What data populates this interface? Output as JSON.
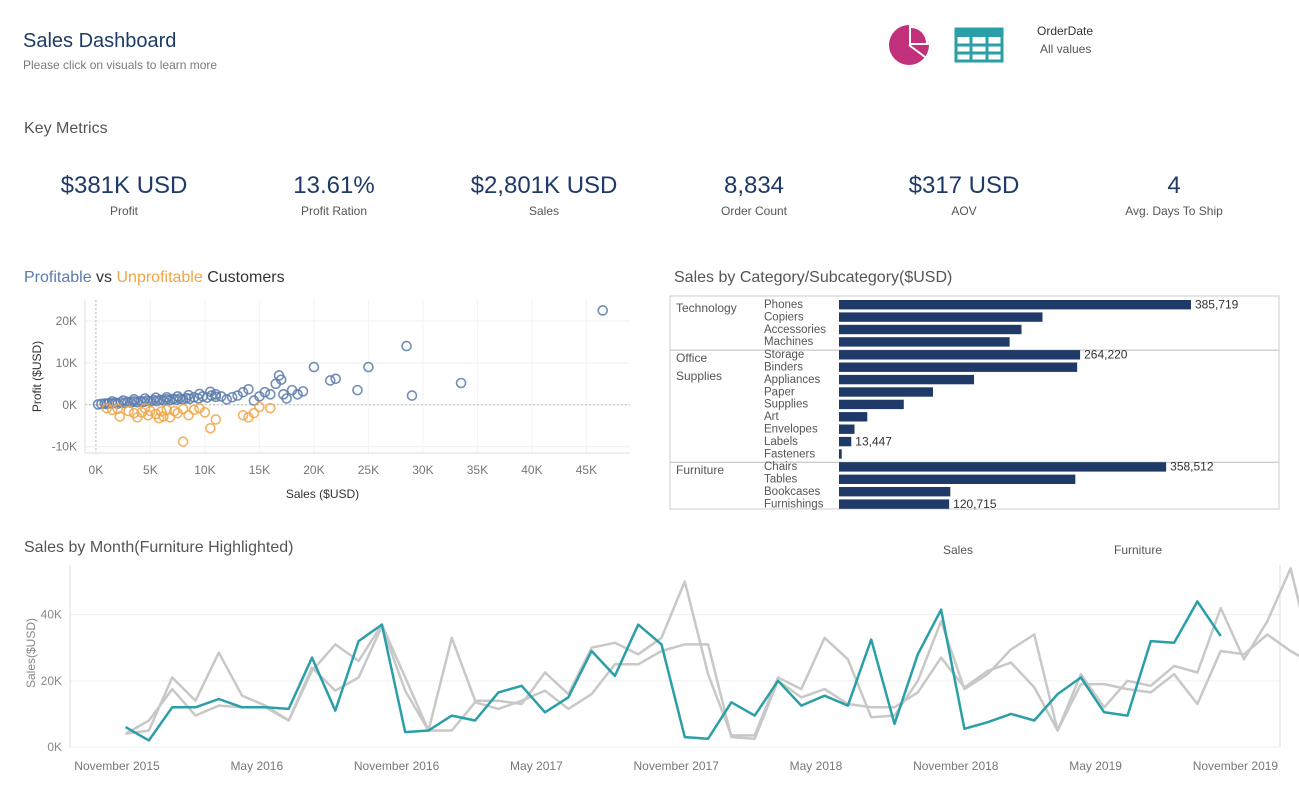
{
  "header": {
    "title": "Sales Dashboard",
    "subtitle": "Please click on visuals to learn more",
    "pie_icon": "pie-chart-icon",
    "table_icon": "table-grid-icon",
    "filter_label": "OrderDate",
    "filter_value": "All values"
  },
  "colors": {
    "navy": "#1f3a68",
    "profitable": "#5b7bab",
    "unprofitable": "#f0a646",
    "teal": "#2a9fa8",
    "gray_line": "#c8c8c8",
    "pie": "#c2307b"
  },
  "key_metrics": {
    "title": "Key Metrics",
    "items": [
      {
        "value": "$381K USD",
        "label": "Profit"
      },
      {
        "value": "13.61%",
        "label": "Profit Ration"
      },
      {
        "value": "$2,801K USD",
        "label": "Sales"
      },
      {
        "value": "8,834",
        "label": "Order Count"
      },
      {
        "value": "$317 USD",
        "label": "AOV"
      },
      {
        "value": "4",
        "label": "Avg. Days To Ship"
      }
    ]
  },
  "scatter_title": {
    "part1": "Profitable",
    "part2": " vs ",
    "part3": "Unprofitable",
    "part4": " Customers"
  },
  "bar_title": "Sales by Category/Subcategory($USD)",
  "line_title": "Sales by Month(Furniture Highlighted)",
  "chart_data": [
    {
      "type": "scatter",
      "xlabel": "Sales ($USD)",
      "ylabel": "Profit ($USD)",
      "xlim": [
        -1000,
        49000
      ],
      "ylim": [
        -11500,
        25000
      ],
      "x_ticks": [
        0,
        5000,
        10000,
        15000,
        20000,
        25000,
        30000,
        35000,
        40000,
        45000
      ],
      "x_tick_labels": [
        "0K",
        "5K",
        "10K",
        "15K",
        "20K",
        "25K",
        "30K",
        "35K",
        "40K",
        "45K"
      ],
      "y_ticks": [
        20000,
        10000,
        0,
        -10000
      ],
      "y_tick_labels": [
        "20K",
        "10K",
        "0K",
        "-10K"
      ],
      "series": [
        {
          "name": "Profitable",
          "points": [
            [
              200,
              100
            ],
            [
              500,
              200
            ],
            [
              800,
              300
            ],
            [
              1000,
              150
            ],
            [
              1200,
              400
            ],
            [
              1500,
              300
            ],
            [
              1800,
              500
            ],
            [
              2000,
              250
            ],
            [
              2300,
              600
            ],
            [
              2600,
              400
            ],
            [
              2900,
              700
            ],
            [
              3200,
              500
            ],
            [
              3500,
              800
            ],
            [
              3800,
              600
            ],
            [
              4100,
              900
            ],
            [
              4400,
              700
            ],
            [
              4700,
              1000
            ],
            [
              5000,
              800
            ],
            [
              5300,
              1100
            ],
            [
              5600,
              900
            ],
            [
              5900,
              1200
            ],
            [
              6200,
              1000
            ],
            [
              6500,
              1300
            ],
            [
              6800,
              1100
            ],
            [
              7100,
              1400
            ],
            [
              7400,
              1200
            ],
            [
              7700,
              1500
            ],
            [
              8000,
              1300
            ],
            [
              8300,
              1600
            ],
            [
              8600,
              1400
            ],
            [
              9000,
              1800
            ],
            [
              9400,
              1500
            ],
            [
              9800,
              2000
            ],
            [
              10200,
              1700
            ],
            [
              10600,
              2200
            ],
            [
              11000,
              1900
            ],
            [
              1500,
              800
            ],
            [
              2500,
              1000
            ],
            [
              3500,
              1300
            ],
            [
              4500,
              1500
            ],
            [
              5500,
              1700
            ],
            [
              6500,
              1800
            ],
            [
              7500,
              2000
            ],
            [
              8500,
              2300
            ],
            [
              9500,
              2600
            ],
            [
              10500,
              3100
            ],
            [
              11000,
              2500
            ],
            [
              11500,
              2000
            ],
            [
              12000,
              1300
            ],
            [
              12500,
              1800
            ],
            [
              13000,
              2200
            ],
            [
              13500,
              3000
            ],
            [
              14000,
              3700
            ],
            [
              14500,
              1000
            ],
            [
              15000,
              2000
            ],
            [
              15500,
              3000
            ],
            [
              16000,
              2500
            ],
            [
              16500,
              5000
            ],
            [
              16800,
              7000
            ],
            [
              17000,
              6000
            ],
            [
              17200,
              2500
            ],
            [
              17500,
              1500
            ],
            [
              18000,
              3500
            ],
            [
              18500,
              2500
            ],
            [
              19000,
              3200
            ],
            [
              20000,
              9000
            ],
            [
              21500,
              5800
            ],
            [
              22000,
              6200
            ],
            [
              24000,
              3500
            ],
            [
              25000,
              9000
            ],
            [
              28500,
              14000
            ],
            [
              29000,
              2200
            ],
            [
              33500,
              5200
            ],
            [
              46500,
              22500
            ]
          ]
        },
        {
          "name": "Unprofitable",
          "points": [
            [
              1000,
              -800
            ],
            [
              1500,
              -1200
            ],
            [
              2000,
              -1000
            ],
            [
              2200,
              -2800
            ],
            [
              3000,
              -1500
            ],
            [
              3500,
              -2000
            ],
            [
              3800,
              -3000
            ],
            [
              4200,
              -1800
            ],
            [
              4500,
              -800
            ],
            [
              4800,
              -2500
            ],
            [
              5000,
              -1500
            ],
            [
              5500,
              -2200
            ],
            [
              5800,
              -3200
            ],
            [
              6000,
              -1600
            ],
            [
              6200,
              -2800
            ],
            [
              6500,
              -1200
            ],
            [
              6800,
              -3000
            ],
            [
              7200,
              -1500
            ],
            [
              7500,
              -2000
            ],
            [
              8000,
              -1000
            ],
            [
              8500,
              -2500
            ],
            [
              9000,
              -1200
            ],
            [
              9500,
              -800
            ],
            [
              10000,
              -1800
            ],
            [
              10500,
              -5600
            ],
            [
              11000,
              -3500
            ],
            [
              8000,
              -8800
            ],
            [
              13500,
              -2500
            ],
            [
              14000,
              -3000
            ],
            [
              14500,
              -2000
            ],
            [
              15000,
              -500
            ],
            [
              16000,
              -800
            ]
          ]
        }
      ]
    },
    {
      "type": "bar",
      "orientation": "horizontal",
      "xlim": [
        0,
        400000
      ],
      "groups": [
        {
          "name_lines": [
            "Technology"
          ],
          "items": [
            {
              "label": "Phones",
              "value": 385719,
              "data_label": "385,719"
            },
            {
              "label": "Copiers",
              "value": 223000,
              "data_label": ""
            },
            {
              "label": "Accessories",
              "value": 200000,
              "data_label": ""
            },
            {
              "label": "Machines",
              "value": 187000,
              "data_label": ""
            }
          ]
        },
        {
          "name_lines": [
            "Office",
            "Supplies"
          ],
          "items": [
            {
              "label": "Storage",
              "value": 264220,
              "data_label": "264,220"
            },
            {
              "label": "Binders",
              "value": 261000,
              "data_label": ""
            },
            {
              "label": "Appliances",
              "value": 148000,
              "data_label": ""
            },
            {
              "label": "Paper",
              "value": 103000,
              "data_label": ""
            },
            {
              "label": "Supplies",
              "value": 71000,
              "data_label": ""
            },
            {
              "label": "Art",
              "value": 31000,
              "data_label": ""
            },
            {
              "label": "Envelopes",
              "value": 17000,
              "data_label": ""
            },
            {
              "label": "Labels",
              "value": 13447,
              "data_label": "13,447"
            },
            {
              "label": "Fasteners",
              "value": 3000,
              "data_label": ""
            }
          ]
        },
        {
          "name_lines": [
            "Furniture"
          ],
          "items": [
            {
              "label": "Chairs",
              "value": 358512,
              "data_label": "358,512"
            },
            {
              "label": "Tables",
              "value": 259000,
              "data_label": ""
            },
            {
              "label": "Bookcases",
              "value": 122000,
              "data_label": ""
            },
            {
              "label": "Furnishings",
              "value": 120715,
              "data_label": "120,715"
            }
          ]
        }
      ]
    },
    {
      "type": "line",
      "ylabel": "Sales($USD)",
      "ylim": [
        0,
        55000
      ],
      "y_ticks": [
        0,
        20000,
        40000
      ],
      "y_tick_labels": [
        "0K",
        "20K",
        "40K"
      ],
      "x_ticks": [
        {
          "label": "November 2015",
          "idx": 0
        },
        {
          "label": "May 2016",
          "idx": 6
        },
        {
          "label": "November 2016",
          "idx": 12
        },
        {
          "label": "May 2017",
          "idx": 18
        },
        {
          "label": "November 2017",
          "idx": 24
        },
        {
          "label": "May 2018",
          "idx": 30
        },
        {
          "label": "November 2018",
          "idx": 36
        },
        {
          "label": "May 2019",
          "idx": 42
        },
        {
          "label": "November 2019",
          "idx": 48
        }
      ],
      "first_point_idx": 2,
      "legend_labels": [
        "Sales",
        "Furniture"
      ],
      "series": [
        {
          "name": "Sales",
          "values": [
            4000,
            5000,
            21000,
            14000,
            28500,
            15500,
            12500,
            8000,
            23000,
            31000,
            26000,
            37000,
            21000,
            5000,
            33000,
            14000,
            14000,
            13000,
            22500,
            16000,
            30000,
            31500,
            28000,
            33000,
            50000,
            22000,
            3500,
            3500,
            21000,
            17500,
            33000,
            26500,
            9000,
            9500,
            20000,
            38000,
            17500,
            22000,
            29500,
            34000,
            5000,
            22000,
            12000,
            20000,
            18500,
            24500,
            22500,
            42000,
            26500,
            38000,
            54000,
            25000
          ]
        },
        {
          "name": "Sales (secondary)",
          "values": [
            4000,
            8000,
            17500,
            9500,
            12500,
            12000,
            12000,
            8000,
            24000,
            17000,
            21000,
            36500,
            17000,
            5000,
            5000,
            13500,
            11500,
            14000,
            17000,
            11500,
            16000,
            25000,
            25000,
            29000,
            31000,
            31000,
            3000,
            2500,
            20000,
            15000,
            17500,
            13000,
            12000,
            12000,
            16500,
            27000,
            18000,
            23000,
            25500,
            18000,
            5000,
            19000,
            19000,
            17500,
            16500,
            22000,
            13000,
            29000,
            28000,
            34000,
            29000,
            25000
          ]
        },
        {
          "name": "Furniture",
          "values": [
            6000,
            2000,
            12000,
            12000,
            14500,
            12000,
            12000,
            11500,
            27000,
            11000,
            32000,
            37000,
            4500,
            5000,
            9500,
            8000,
            16500,
            18500,
            10500,
            15000,
            29000,
            21500,
            37000,
            31000,
            3000,
            2500,
            13500,
            9500,
            20000,
            12500,
            15500,
            12500,
            32500,
            7000,
            28000,
            41500,
            5500,
            7500,
            10000,
            8000,
            16000,
            21000,
            10500,
            9500,
            32000,
            31500,
            44000,
            33500
          ]
        }
      ]
    }
  ]
}
